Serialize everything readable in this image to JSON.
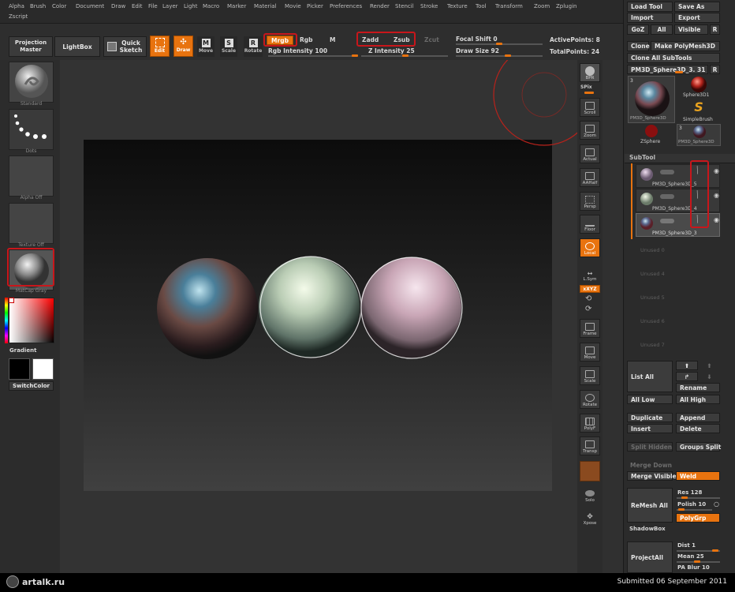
{
  "menu": [
    "Alpha",
    "Brush",
    "Color",
    "Document",
    "Draw",
    "Edit",
    "File",
    "Layer",
    "Light",
    "Macro",
    "Marker",
    "Material",
    "Movie",
    "Picker",
    "Preferences",
    "Render",
    "Stencil",
    "Stroke",
    "Texture",
    "Tool",
    "Transform",
    "Zoom",
    "Zplugin",
    "Zscript"
  ],
  "shelf": {
    "projection_master": "Projection Master",
    "lightbox": "LightBox",
    "quick_sketch": "Quick Sketch",
    "edit": "Edit",
    "draw": "Draw",
    "move": "Move",
    "scale": "Scale",
    "rotate": "Rotate",
    "mrgb": "Mrgb",
    "rgb": "Rgb",
    "m": "M",
    "rgb_intensity": "Rgb Intensity 100",
    "rgb_intensity_value": 100,
    "zadd": "Zadd",
    "zsub": "Zsub",
    "zcut": "Zcut",
    "z_intensity": "Z Intensity 25",
    "z_intensity_value": 25,
    "focal_shift": "Focal Shift 0",
    "focal_shift_value": 0,
    "draw_size": "Draw Size 92",
    "draw_size_value": 92,
    "active_points": "ActivePoints: 8",
    "total_points": "TotalPoints: 24"
  },
  "left": {
    "brush_label": "Standard",
    "stroke_label": "Dots",
    "alpha_label": "Alpha Off",
    "texture_label": "Texture Off",
    "material_label": "MatCap Gray",
    "gradient": "Gradient",
    "switch_color": "SwitchColor"
  },
  "rtool": [
    "BPR",
    "SPix",
    "Scroll",
    "Zoom",
    "Actual",
    "AAHalf",
    "Persp",
    "Floor",
    "Local",
    "L.Sym",
    "xXYZ",
    "",
    "",
    "Frame",
    "Move",
    "Scale",
    "Rotate",
    "PolyF",
    "Transp",
    "",
    "Solo",
    "Xpose"
  ],
  "palette": {
    "load_tool": "Load Tool",
    "save_as": "Save As",
    "import": "Import",
    "export": "Export",
    "goz": "GoZ",
    "all": "All",
    "visible": "Visible",
    "r": "R",
    "clone": "Clone",
    "make_polymesh": "Make PolyMesh3D",
    "clone_all_subtools": "Clone All SubTools",
    "current_tool": "PM3D_Sphere3D_3. 31",
    "tool_thumbs": [
      "PM3D_Sphere3D",
      "Sphere3D1",
      "SimpleBrush",
      "ZSphere",
      "PM3D_Sphere3D"
    ],
    "thumb_counts": [
      "3",
      "3"
    ],
    "subtool_header": "SubTool",
    "subtools": [
      "PM3D_Sphere3D_5",
      "PM3D_Sphere3D_4",
      "PM3D_Sphere3D_3"
    ],
    "unused": [
      "Unused 0",
      "Unused 4",
      "Unused 5",
      "Unused 6",
      "Unused 7"
    ],
    "list_all": "List All",
    "rename": "Rename",
    "all_low": "All Low",
    "all_high": "All High",
    "duplicate": "Duplicate",
    "append": "Append",
    "insert": "Insert",
    "delete": "Delete",
    "split_hidden": "Split Hidden",
    "groups_split": "Groups Split",
    "merge_down": "Merge Down",
    "merge_visible": "Merge Visible",
    "weld": "Weld",
    "remesh_all": "ReMesh All",
    "res": "Res 128",
    "res_value": 128,
    "polish": "Polish 10",
    "polish_value": 10,
    "polygrp": "PolyGrp",
    "shadowbox": "ShadowBox",
    "project_all": "ProjectAll",
    "dist": "Dist 1",
    "dist_value": 1,
    "mean": "Mean 25",
    "mean_value": 25,
    "pa_blur": "PA Blur 10",
    "pa_blur_value": 10
  },
  "footer": {
    "logo": "artalk.ru",
    "submitted": "Submitted 06 September 2011"
  },
  "colors": {
    "accent": "#e8730f",
    "highlight": "#c8161b"
  }
}
